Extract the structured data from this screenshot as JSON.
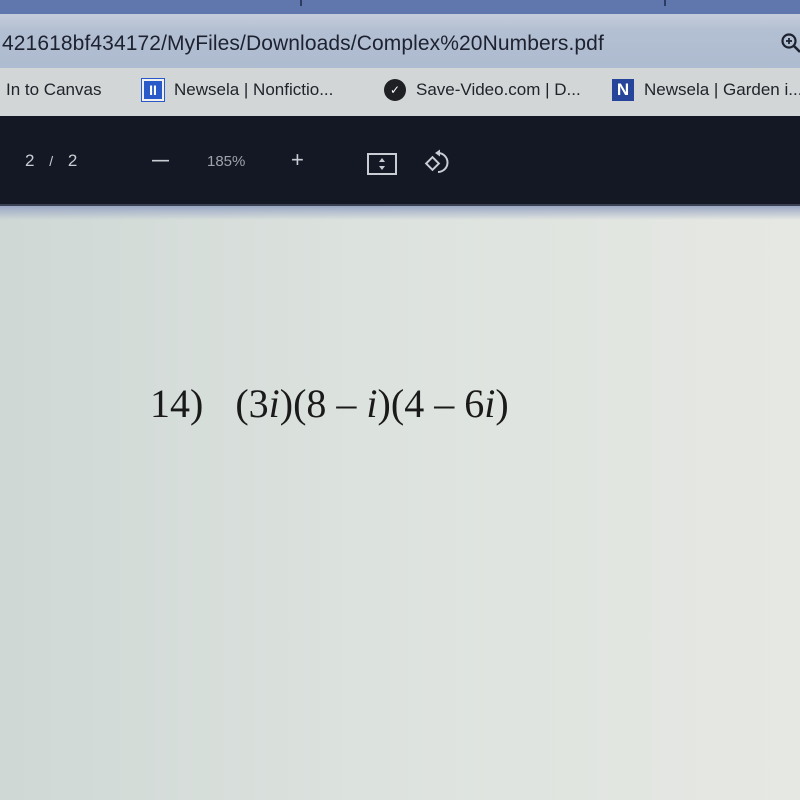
{
  "browser": {
    "address_bar": {
      "url_text": "421618bf434172/MyFiles/Downloads/Complex%20Numbers.pdf",
      "zoom_icon": "zoom-in-magnifier-icon"
    },
    "bookmarks": [
      {
        "label": "In to Canvas",
        "icon": "none"
      },
      {
        "label": "Newsela | Nonfictio...",
        "icon": "newsela-bars-icon",
        "icon_glyph": "II"
      },
      {
        "label": "Save-Video.com | D...",
        "icon": "save-video-icon",
        "icon_glyph": "✓"
      },
      {
        "label": "Newsela | Garden i...",
        "icon": "newsela-n-icon",
        "icon_glyph": "N"
      }
    ]
  },
  "pdf_toolbar": {
    "current_page": "2",
    "separator": "/",
    "total_pages": "2",
    "zoom_out_label": "—",
    "zoom_level": "185%",
    "zoom_in_label": "+",
    "fit_page_icon": "fit-to-page-icon",
    "rotate_icon": "rotate-icon"
  },
  "document": {
    "problem_number": "14)",
    "problem_expression_parts": [
      "(3",
      "i",
      ")(8 – ",
      "i",
      ")(4 – 6",
      "i",
      ")"
    ]
  },
  "colors": {
    "toolbar_bg": "#141824",
    "address_bar_bg": "#b3bfd2",
    "bookmarks_bg": "#d3d6d6",
    "page_bg": "#dce2de",
    "newsela_blue": "#2a59c9"
  }
}
